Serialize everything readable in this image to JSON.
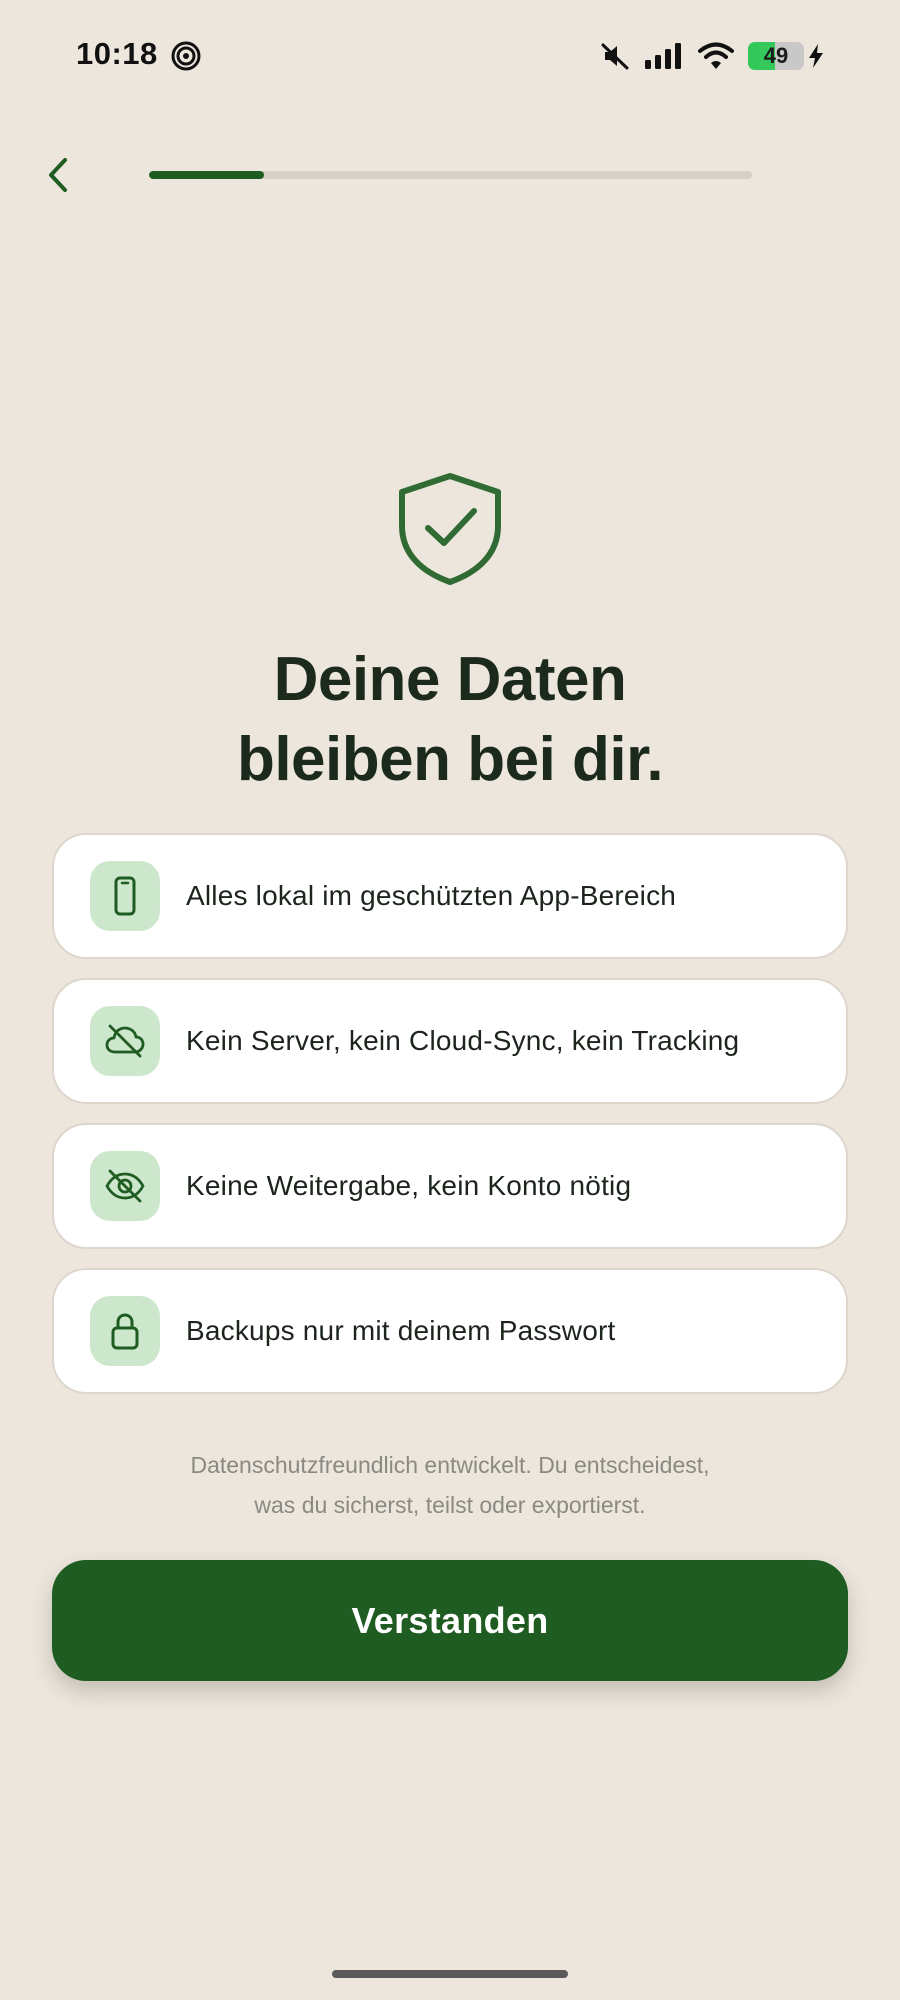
{
  "status_bar": {
    "time": "10:18",
    "app_icon": "spiral-icon",
    "icons": [
      "mute-icon",
      "signal-icon",
      "wifi-icon",
      "battery-icon",
      "charging-icon"
    ],
    "battery": "49",
    "battery_level": 0.49
  },
  "nav": {
    "back_icon": "chevron-left-icon",
    "progress": 0.19
  },
  "hero": {
    "icon": "shield-check-icon",
    "title_line1": "Deine Daten",
    "title_line2": "bleiben bei dir."
  },
  "features": [
    {
      "icon": "smartphone-icon",
      "text": "Alles lokal im geschützten App-Bereich"
    },
    {
      "icon": "cloud-off-icon",
      "text": "Kein Server, kein Cloud-Sync, kein Tracking"
    },
    {
      "icon": "eye-off-icon",
      "text": "Keine Weitergabe, kein Konto nötig"
    },
    {
      "icon": "lock-icon",
      "text": "Backups nur mit deinem Passwort"
    }
  ],
  "footnote": {
    "line1": "Datenschutzfreundlich entwickelt. Du entscheidest,",
    "line2": "was du sicherst, teilst oder exportierst."
  },
  "cta": {
    "label": "Verstanden"
  },
  "colors": {
    "background": "#ede6dd",
    "primary": "#1f5c22",
    "icon_tile": "#cde7cd",
    "card": "#ffffff",
    "muted_text": "#8a8a83"
  }
}
